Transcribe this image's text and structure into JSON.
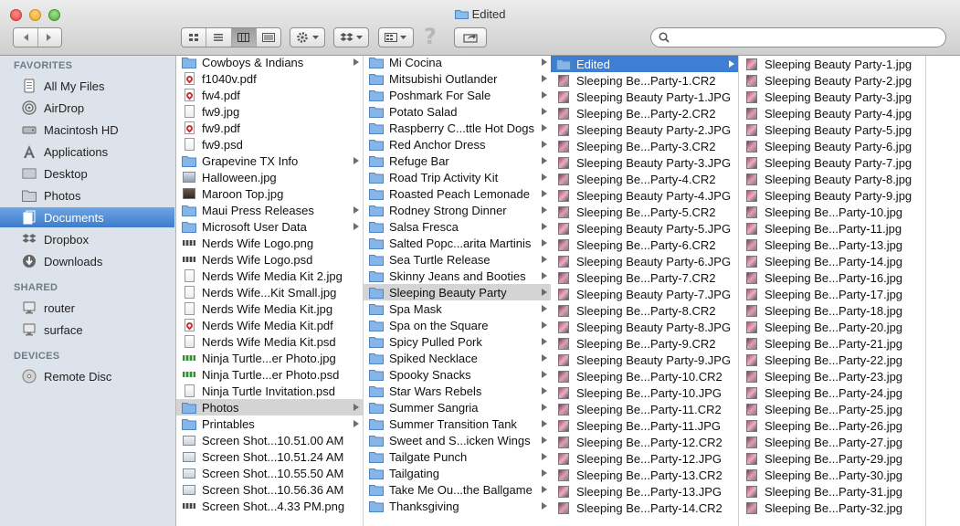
{
  "window": {
    "title": "Edited"
  },
  "toolbar": {
    "help_glyph": "?",
    "search_placeholder": ""
  },
  "sidebar": {
    "favorites_header": "FAVORITES",
    "favorites": [
      {
        "label": "All My Files",
        "icon": "all-my-files-icon"
      },
      {
        "label": "AirDrop",
        "icon": "airdrop-icon"
      },
      {
        "label": "Macintosh HD",
        "icon": "hard-drive-icon"
      },
      {
        "label": "Applications",
        "icon": "applications-icon"
      },
      {
        "label": "Desktop",
        "icon": "desktop-icon"
      },
      {
        "label": "Photos",
        "icon": "folder-icon"
      },
      {
        "label": "Documents",
        "icon": "documents-icon",
        "selected": true
      },
      {
        "label": "Dropbox",
        "icon": "dropbox-icon"
      },
      {
        "label": "Downloads",
        "icon": "downloads-icon"
      }
    ],
    "shared_header": "SHARED",
    "shared": [
      {
        "label": "router",
        "icon": "computer-icon"
      },
      {
        "label": "surface",
        "icon": "computer-icon"
      }
    ],
    "devices_header": "DEVICES",
    "devices": [
      {
        "label": "Remote Disc",
        "icon": "disc-icon"
      }
    ]
  },
  "columns": {
    "col1": [
      {
        "name": "Cowboys & Indians",
        "kind": "folder",
        "arrow": true
      },
      {
        "name": "f1040v.pdf",
        "kind": "pdf"
      },
      {
        "name": "fw4.pdf",
        "kind": "pdf"
      },
      {
        "name": "fw9.jpg",
        "kind": "doc"
      },
      {
        "name": "fw9.pdf",
        "kind": "pdf"
      },
      {
        "name": "fw9.psd",
        "kind": "doc"
      },
      {
        "name": "Grapevine TX Info",
        "kind": "folder",
        "arrow": true
      },
      {
        "name": "Halloween.jpg",
        "kind": "img"
      },
      {
        "name": "Maroon Top.jpg",
        "kind": "mtop"
      },
      {
        "name": "Maui Press Releases",
        "kind": "folder",
        "arrow": true
      },
      {
        "name": "Microsoft User Data",
        "kind": "folder",
        "arrow": true
      },
      {
        "name": "Nerds Wife Logo.png",
        "kind": "logo"
      },
      {
        "name": "Nerds Wife Logo.psd",
        "kind": "logo"
      },
      {
        "name": "Nerds Wife Media Kit 2.jpg",
        "kind": "doc"
      },
      {
        "name": "Nerds Wife...Kit Small.jpg",
        "kind": "doc"
      },
      {
        "name": "Nerds Wife Media Kit.jpg",
        "kind": "doc"
      },
      {
        "name": "Nerds Wife Media Kit.pdf",
        "kind": "pdf"
      },
      {
        "name": "Nerds Wife Media Kit.psd",
        "kind": "psd"
      },
      {
        "name": "Ninja Turtle...er Photo.jpg",
        "kind": "ninja"
      },
      {
        "name": "Ninja Turtle...er Photo.psd",
        "kind": "ninja"
      },
      {
        "name": "Ninja Turtle Invitation.psd",
        "kind": "psd"
      },
      {
        "name": "Photos",
        "kind": "folder",
        "arrow": true,
        "selected": "gray"
      },
      {
        "name": "Printables",
        "kind": "folder",
        "arrow": true
      },
      {
        "name": "Screen Shot...10.51.00 AM",
        "kind": "shot"
      },
      {
        "name": "Screen Shot...10.51.24 AM",
        "kind": "shot"
      },
      {
        "name": "Screen Shot...10.55.50 AM",
        "kind": "shot"
      },
      {
        "name": "Screen Shot...10.56.36 AM",
        "kind": "shot"
      },
      {
        "name": "Screen Shot...4.33 PM.png",
        "kind": "logo"
      }
    ],
    "col2": [
      {
        "name": "Mi Cocina",
        "kind": "folder",
        "arrow": true
      },
      {
        "name": "Mitsubishi Outlander",
        "kind": "folder",
        "arrow": true
      },
      {
        "name": "Poshmark For Sale",
        "kind": "folder",
        "arrow": true
      },
      {
        "name": "Potato Salad",
        "kind": "folder",
        "arrow": true
      },
      {
        "name": "Raspberry C...ttle Hot Dogs",
        "kind": "folder",
        "arrow": true
      },
      {
        "name": "Red Anchor Dress",
        "kind": "folder",
        "arrow": true
      },
      {
        "name": "Refuge Bar",
        "kind": "folder",
        "arrow": true
      },
      {
        "name": "Road Trip Activity Kit",
        "kind": "folder",
        "arrow": true
      },
      {
        "name": "Roasted Peach Lemonade",
        "kind": "folder",
        "arrow": true
      },
      {
        "name": "Rodney Strong Dinner",
        "kind": "folder",
        "arrow": true
      },
      {
        "name": "Salsa Fresca",
        "kind": "folder",
        "arrow": true
      },
      {
        "name": "Salted Popc...arita Martinis",
        "kind": "folder",
        "arrow": true
      },
      {
        "name": "Sea Turtle Release",
        "kind": "folder",
        "arrow": true
      },
      {
        "name": "Skinny Jeans and Booties",
        "kind": "folder",
        "arrow": true
      },
      {
        "name": "Sleeping Beauty Party",
        "kind": "folder",
        "arrow": true,
        "selected": "gray"
      },
      {
        "name": "Spa Mask",
        "kind": "folder",
        "arrow": true
      },
      {
        "name": "Spa on the Square",
        "kind": "folder",
        "arrow": true
      },
      {
        "name": "Spicy Pulled Pork",
        "kind": "folder",
        "arrow": true
      },
      {
        "name": "Spiked Necklace",
        "kind": "folder",
        "arrow": true
      },
      {
        "name": "Spooky Snacks",
        "kind": "folder",
        "arrow": true
      },
      {
        "name": "Star Wars Rebels",
        "kind": "folder",
        "arrow": true
      },
      {
        "name": "Summer Sangria",
        "kind": "folder",
        "arrow": true
      },
      {
        "name": "Summer Transition Tank",
        "kind": "folder",
        "arrow": true
      },
      {
        "name": "Sweet and S...icken Wings",
        "kind": "folder",
        "arrow": true
      },
      {
        "name": "Tailgate Punch",
        "kind": "folder",
        "arrow": true
      },
      {
        "name": "Tailgating",
        "kind": "folder",
        "arrow": true
      },
      {
        "name": "Take Me Ou...the Ballgame",
        "kind": "folder",
        "arrow": true
      },
      {
        "name": "Thanksgiving",
        "kind": "folder",
        "arrow": true
      }
    ],
    "col3": [
      {
        "name": "Edited",
        "kind": "folder",
        "arrow": true,
        "selected": "blue"
      },
      {
        "name": "Sleeping Be...Party-1.CR2",
        "kind": "thumb"
      },
      {
        "name": "Sleeping Beauty Party-1.JPG",
        "kind": "thumb"
      },
      {
        "name": "Sleeping Be...Party-2.CR2",
        "kind": "thumb"
      },
      {
        "name": "Sleeping Beauty Party-2.JPG",
        "kind": "thumb"
      },
      {
        "name": "Sleeping Be...Party-3.CR2",
        "kind": "thumb"
      },
      {
        "name": "Sleeping Beauty Party-3.JPG",
        "kind": "thumb"
      },
      {
        "name": "Sleeping Be...Party-4.CR2",
        "kind": "thumb"
      },
      {
        "name": "Sleeping Beauty Party-4.JPG",
        "kind": "thumb"
      },
      {
        "name": "Sleeping Be...Party-5.CR2",
        "kind": "thumb"
      },
      {
        "name": "Sleeping Beauty Party-5.JPG",
        "kind": "thumb"
      },
      {
        "name": "Sleeping Be...Party-6.CR2",
        "kind": "thumb"
      },
      {
        "name": "Sleeping Beauty Party-6.JPG",
        "kind": "thumb"
      },
      {
        "name": "Sleeping Be...Party-7.CR2",
        "kind": "thumb"
      },
      {
        "name": "Sleeping Beauty Party-7.JPG",
        "kind": "thumb"
      },
      {
        "name": "Sleeping Be...Party-8.CR2",
        "kind": "thumb"
      },
      {
        "name": "Sleeping Beauty Party-8.JPG",
        "kind": "thumb"
      },
      {
        "name": "Sleeping Be...Party-9.CR2",
        "kind": "thumb"
      },
      {
        "name": "Sleeping Beauty Party-9.JPG",
        "kind": "thumb"
      },
      {
        "name": "Sleeping Be...Party-10.CR2",
        "kind": "thumb"
      },
      {
        "name": "Sleeping Be...Party-10.JPG",
        "kind": "thumb"
      },
      {
        "name": "Sleeping Be...Party-11.CR2",
        "kind": "thumb"
      },
      {
        "name": "Sleeping Be...Party-11.JPG",
        "kind": "thumb"
      },
      {
        "name": "Sleeping Be...Party-12.CR2",
        "kind": "thumb"
      },
      {
        "name": "Sleeping Be...Party-12.JPG",
        "kind": "thumb"
      },
      {
        "name": "Sleeping Be...Party-13.CR2",
        "kind": "thumb"
      },
      {
        "name": "Sleeping Be...Party-13.JPG",
        "kind": "thumb"
      },
      {
        "name": "Sleeping Be...Party-14.CR2",
        "kind": "thumb"
      }
    ],
    "col4": [
      {
        "name": "Sleeping Beauty Party-1.jpg",
        "kind": "thumb"
      },
      {
        "name": "Sleeping Beauty Party-2.jpg",
        "kind": "thumb"
      },
      {
        "name": "Sleeping Beauty Party-3.jpg",
        "kind": "thumb"
      },
      {
        "name": "Sleeping Beauty Party-4.jpg",
        "kind": "thumb"
      },
      {
        "name": "Sleeping Beauty Party-5.jpg",
        "kind": "thumb"
      },
      {
        "name": "Sleeping Beauty Party-6.jpg",
        "kind": "thumb"
      },
      {
        "name": "Sleeping Beauty Party-7.jpg",
        "kind": "thumb"
      },
      {
        "name": "Sleeping Beauty Party-8.jpg",
        "kind": "thumb"
      },
      {
        "name": "Sleeping Beauty Party-9.jpg",
        "kind": "thumb"
      },
      {
        "name": "Sleeping Be...Party-10.jpg",
        "kind": "thumb"
      },
      {
        "name": "Sleeping Be...Party-11.jpg",
        "kind": "thumb"
      },
      {
        "name": "Sleeping Be...Party-13.jpg",
        "kind": "thumb"
      },
      {
        "name": "Sleeping Be...Party-14.jpg",
        "kind": "thumb"
      },
      {
        "name": "Sleeping Be...Party-16.jpg",
        "kind": "thumb"
      },
      {
        "name": "Sleeping Be...Party-17.jpg",
        "kind": "thumb"
      },
      {
        "name": "Sleeping Be...Party-18.jpg",
        "kind": "thumb"
      },
      {
        "name": "Sleeping Be...Party-20.jpg",
        "kind": "thumb"
      },
      {
        "name": "Sleeping Be...Party-21.jpg",
        "kind": "thumb"
      },
      {
        "name": "Sleeping Be...Party-22.jpg",
        "kind": "thumb"
      },
      {
        "name": "Sleeping Be...Party-23.jpg",
        "kind": "thumb"
      },
      {
        "name": "Sleeping Be...Party-24.jpg",
        "kind": "thumb"
      },
      {
        "name": "Sleeping Be...Party-25.jpg",
        "kind": "thumb"
      },
      {
        "name": "Sleeping Be...Party-26.jpg",
        "kind": "thumb"
      },
      {
        "name": "Sleeping Be...Party-27.jpg",
        "kind": "thumb"
      },
      {
        "name": "Sleeping Be...Party-29.jpg",
        "kind": "thumb"
      },
      {
        "name": "Sleeping Be...Party-30.jpg",
        "kind": "thumb"
      },
      {
        "name": "Sleeping Be...Party-31.jpg",
        "kind": "thumb"
      },
      {
        "name": "Sleeping Be...Party-32.jpg",
        "kind": "thumb"
      }
    ]
  },
  "colors": {
    "selection_blue": "#3f7fd3",
    "selection_gray": "#d4d4d4",
    "sidebar_bg": "#dde3ea",
    "folder_blue": "#7fb2e6"
  }
}
